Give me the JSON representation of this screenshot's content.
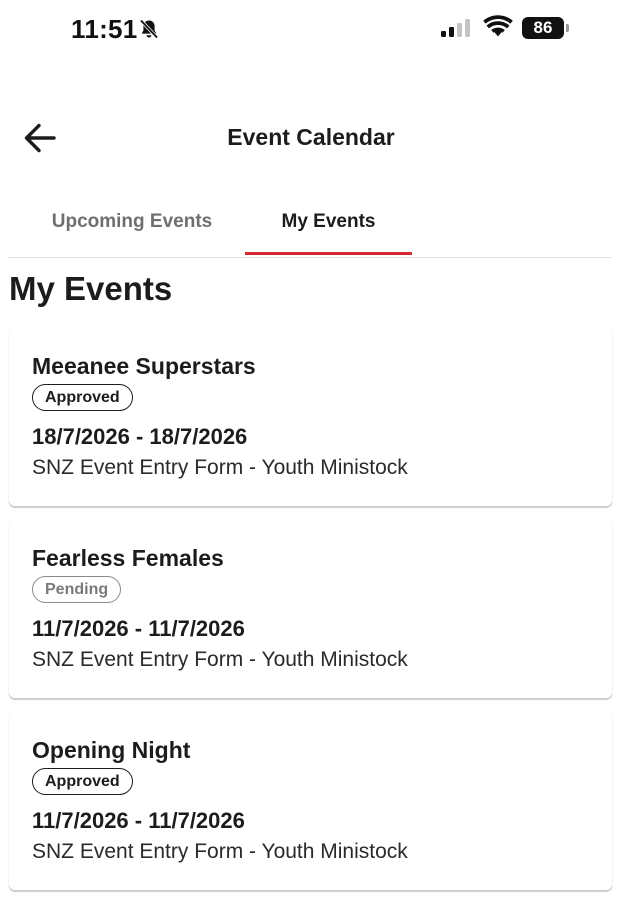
{
  "status_bar": {
    "time": "11:51",
    "battery_level": "86",
    "icons": [
      "bell-slash-icon",
      "cellular-signal-icon",
      "wifi-icon",
      "battery-icon"
    ]
  },
  "header": {
    "title": "Event Calendar",
    "back_icon": "arrow-left-icon"
  },
  "tabs": [
    {
      "label": "Upcoming Events",
      "active": false
    },
    {
      "label": "My Events",
      "active": true
    }
  ],
  "section": {
    "heading": "My Events"
  },
  "events": [
    {
      "title": "Meeanee Superstars",
      "status": "Approved",
      "dates": "18/7/2026 - 18/7/2026",
      "form": "SNZ Event Entry Form - Youth Ministock"
    },
    {
      "title": "Fearless Females",
      "status": "Pending",
      "dates": "11/7/2026 - 11/7/2026",
      "form": "SNZ Event Entry Form - Youth Ministock"
    },
    {
      "title": "Opening Night",
      "status": "Approved",
      "dates": "11/7/2026 - 11/7/2026",
      "form": "SNZ Event Entry Form - Youth Ministock"
    }
  ],
  "colors": {
    "accent": "#d7282f",
    "text": "#1c1c1c",
    "inactive_tab": "#6f6f6f",
    "pending": "#8a8a8a"
  }
}
